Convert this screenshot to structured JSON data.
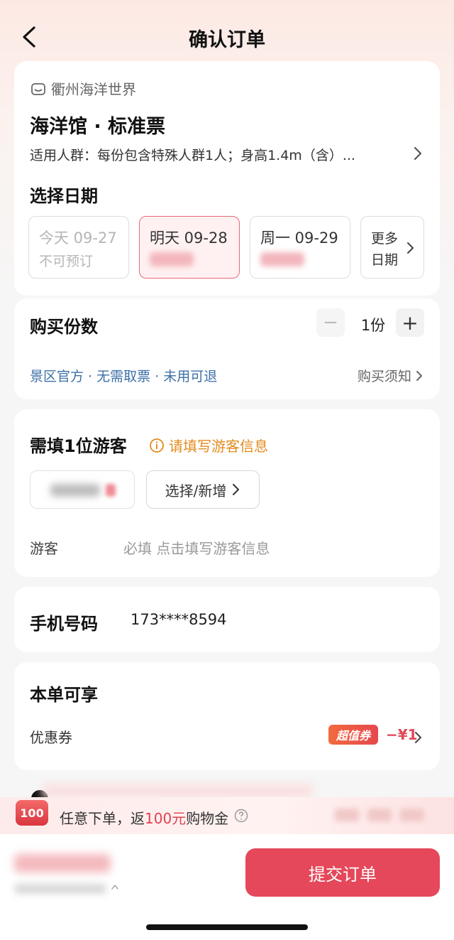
{
  "header": {
    "title": "确认订单"
  },
  "ticket": {
    "venue": "衢州海洋世界",
    "title": "海洋馆 · 标准票",
    "audience": "适用人群：每份包含特殊人群1人；身高1.4m（含）..."
  },
  "date": {
    "label": "选择日期",
    "options": [
      {
        "date": "今天 09-27",
        "sub": "不可预订"
      },
      {
        "date": "明天 09-28"
      },
      {
        "date": "周一 09-29"
      }
    ],
    "more_line1": "更多",
    "more_line2": "日期"
  },
  "quantity": {
    "label": "购买份数",
    "minus": "−",
    "plus": "+",
    "value": "1份",
    "features": "景区官方 · 无需取票 · 未用可退",
    "notice": "购买须知"
  },
  "visitor": {
    "need": "需填1位游客",
    "warning": "请填写游客信息",
    "add_button": "选择/新增",
    "guest_label": "游客",
    "guest_hint": "必填 点击填写游客信息"
  },
  "phone": {
    "label": "手机号码",
    "value": "173****8594"
  },
  "benefits": {
    "title": "本单可享",
    "coupon_label": "优惠券",
    "coupon_badge": "超值券",
    "coupon_value": "−¥1"
  },
  "promo": {
    "badge": "100",
    "text_before": "任意下单，返",
    "text_highlight": "100元",
    "text_after": "购物金"
  },
  "footer": {
    "submit": "提交订单"
  },
  "colors": {
    "accent": "#e5485a",
    "link": "#3d6fa8",
    "warning": "#e38b1e"
  }
}
